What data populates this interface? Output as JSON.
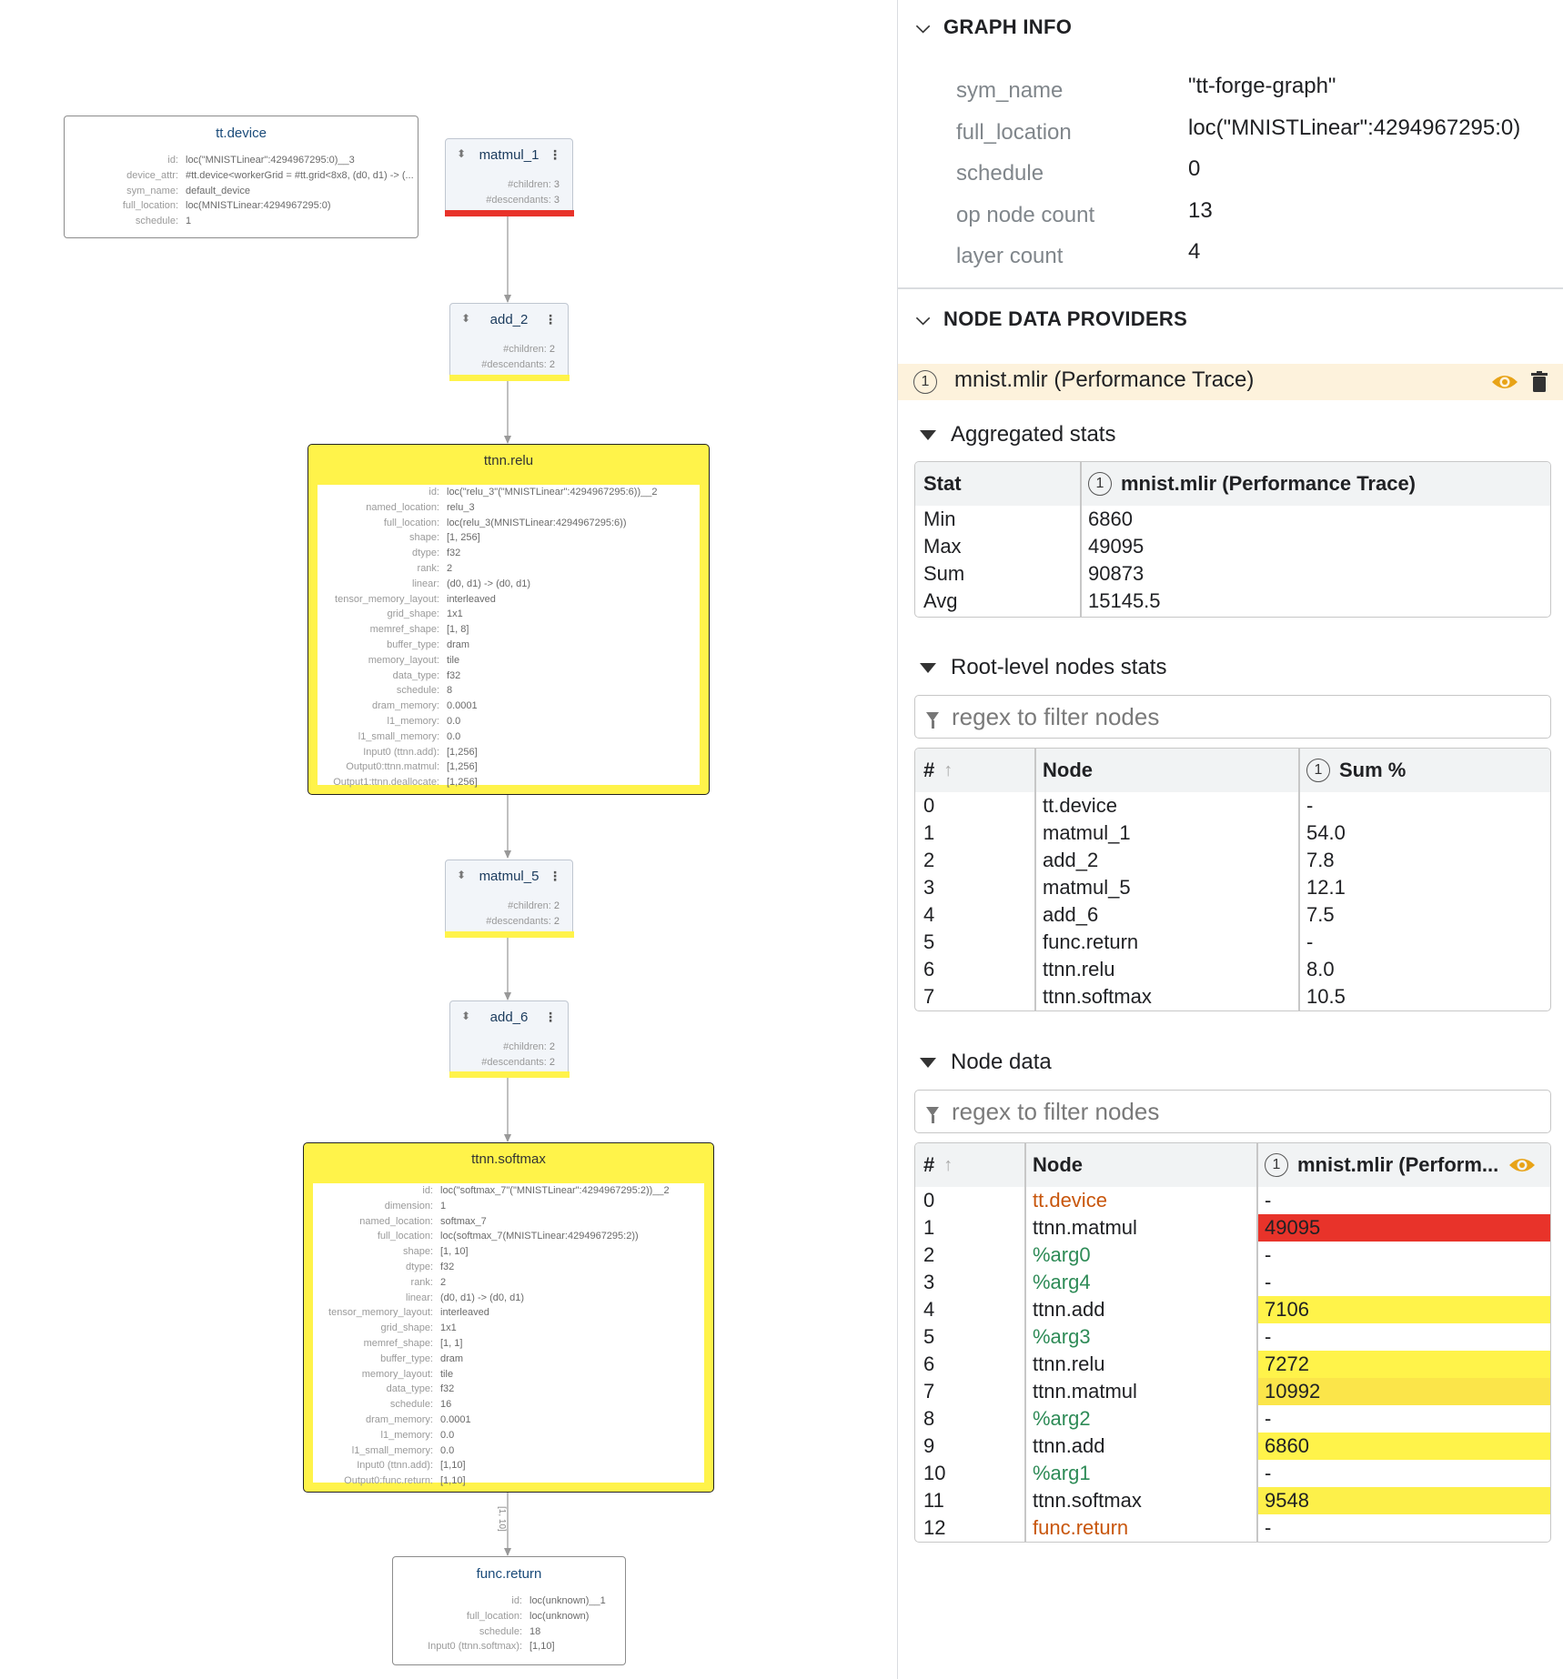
{
  "graph": {
    "tt_device": {
      "title": "tt.device",
      "attrs": [
        {
          "k": "id:",
          "v": "loc(\"MNISTLinear\":4294967295:0)__3"
        },
        {
          "k": "device_attr:",
          "v": "#tt.device<workerGrid = #tt.grid<8x8, (d0, d1) -> (..."
        },
        {
          "k": "sym_name:",
          "v": "default_device"
        },
        {
          "k": "full_location:",
          "v": "loc(MNISTLinear:4294967295:0)"
        },
        {
          "k": "schedule:",
          "v": "1"
        }
      ]
    },
    "groups": [
      {
        "name": "matmul_1",
        "children_label": "#children:",
        "children": "3",
        "descendants_label": "#descendants:",
        "descendants": "3",
        "bar_color": "#e8332a"
      },
      {
        "name": "add_2",
        "children_label": "#children:",
        "children": "2",
        "descendants_label": "#descendants:",
        "descendants": "2",
        "bar_color": "#fff34a"
      },
      {
        "name": "matmul_5",
        "children_label": "#children:",
        "children": "2",
        "descendants_label": "#descendants:",
        "descendants": "2",
        "bar_color": "#fff34a"
      },
      {
        "name": "add_6",
        "children_label": "#children:",
        "children": "2",
        "descendants_label": "#descendants:",
        "descendants": "2",
        "bar_color": "#fff34a"
      }
    ],
    "ttnn_relu": {
      "title": "ttnn.relu",
      "fill": "#fff34a",
      "attrs": [
        {
          "k": "id:",
          "v": "loc(\"relu_3\"(\"MNISTLinear\":4294967295:6))__2"
        },
        {
          "k": "named_location:",
          "v": "relu_3"
        },
        {
          "k": "full_location:",
          "v": "loc(relu_3(MNISTLinear:4294967295:6))"
        },
        {
          "k": "shape:",
          "v": "[1, 256]"
        },
        {
          "k": "dtype:",
          "v": "f32"
        },
        {
          "k": "rank:",
          "v": "2"
        },
        {
          "k": "linear:",
          "v": "(d0, d1) -> (d0, d1)"
        },
        {
          "k": "tensor_memory_layout:",
          "v": "interleaved"
        },
        {
          "k": "grid_shape:",
          "v": "1x1"
        },
        {
          "k": "memref_shape:",
          "v": "[1, 8]"
        },
        {
          "k": "buffer_type:",
          "v": "dram"
        },
        {
          "k": "memory_layout:",
          "v": "tile"
        },
        {
          "k": "data_type:",
          "v": "f32"
        },
        {
          "k": "schedule:",
          "v": "8"
        },
        {
          "k": "dram_memory:",
          "v": "0.0001"
        },
        {
          "k": "l1_memory:",
          "v": "0.0"
        },
        {
          "k": "l1_small_memory:",
          "v": "0.0"
        },
        {
          "k": "Input0 (ttnn.add):",
          "v": "[1,256]"
        },
        {
          "k": "Output0:ttnn.matmul:",
          "v": "[1,256]"
        },
        {
          "k": "Output1:ttnn.deallocate:",
          "v": "[1,256]"
        }
      ]
    },
    "ttnn_softmax": {
      "title": "ttnn.softmax",
      "fill": "#fff34a",
      "attrs": [
        {
          "k": "id:",
          "v": "loc(\"softmax_7\"(\"MNISTLinear\":4294967295:2))__2"
        },
        {
          "k": "dimension:",
          "v": "1"
        },
        {
          "k": "named_location:",
          "v": "softmax_7"
        },
        {
          "k": "full_location:",
          "v": "loc(softmax_7(MNISTLinear:4294967295:2))"
        },
        {
          "k": "shape:",
          "v": "[1, 10]"
        },
        {
          "k": "dtype:",
          "v": "f32"
        },
        {
          "k": "rank:",
          "v": "2"
        },
        {
          "k": "linear:",
          "v": "(d0, d1) -> (d0, d1)"
        },
        {
          "k": "tensor_memory_layout:",
          "v": "interleaved"
        },
        {
          "k": "grid_shape:",
          "v": "1x1"
        },
        {
          "k": "memref_shape:",
          "v": "[1, 1]"
        },
        {
          "k": "buffer_type:",
          "v": "dram"
        },
        {
          "k": "memory_layout:",
          "v": "tile"
        },
        {
          "k": "data_type:",
          "v": "f32"
        },
        {
          "k": "schedule:",
          "v": "16"
        },
        {
          "k": "dram_memory:",
          "v": "0.0001"
        },
        {
          "k": "l1_memory:",
          "v": "0.0"
        },
        {
          "k": "l1_small_memory:",
          "v": "0.0"
        },
        {
          "k": "Input0 (ttnn.add):",
          "v": "[1,10]"
        },
        {
          "k": "Output0:func.return:",
          "v": "[1,10]"
        }
      ]
    },
    "func_return": {
      "title": "func.return",
      "attrs": [
        {
          "k": "id:",
          "v": "loc(unknown)__1"
        },
        {
          "k": "full_location:",
          "v": "loc(unknown)"
        },
        {
          "k": "schedule:",
          "v": "18"
        },
        {
          "k": "Input0 (ttnn.softmax):",
          "v": "[1,10]"
        }
      ]
    },
    "edge_label": "[1, 10]"
  },
  "panel": {
    "graph_info": {
      "title": "GRAPH INFO",
      "rows": [
        {
          "k": "sym_name",
          "v": "\"tt-forge-graph\""
        },
        {
          "k": "full_location",
          "v": "loc(\"MNISTLinear\":4294967295:0)"
        },
        {
          "k": "schedule",
          "v": "0"
        },
        {
          "k": "op node count",
          "v": "13"
        },
        {
          "k": "layer count",
          "v": "4"
        }
      ]
    },
    "node_data_providers": {
      "title": "NODE DATA PROVIDERS",
      "provider_index": "1",
      "provider_name": "mnist.mlir (Performance Trace)",
      "eye_icon": "eye-icon",
      "trash_icon": "trash-icon"
    },
    "aggregated": {
      "title": "Aggregated stats",
      "col_stat": "Stat",
      "col_index": "1",
      "col_provider": "mnist.mlir (Performance Trace)",
      "rows": [
        {
          "stat": "Min",
          "value": "6860"
        },
        {
          "stat": "Max",
          "value": "49095"
        },
        {
          "stat": "Sum",
          "value": "90873"
        },
        {
          "stat": "Avg",
          "value": "15145.5"
        }
      ]
    },
    "root_stats": {
      "title": "Root-level nodes stats",
      "filter_placeholder": "regex to filter nodes",
      "col_hash": "#",
      "col_node": "Node",
      "col_index": "1",
      "col_sum": "Sum %",
      "rows": [
        {
          "i": "0",
          "node": "tt.device",
          "sum": "-"
        },
        {
          "i": "1",
          "node": "matmul_1",
          "sum": "54.0"
        },
        {
          "i": "2",
          "node": "add_2",
          "sum": "7.8"
        },
        {
          "i": "3",
          "node": "matmul_5",
          "sum": "12.1"
        },
        {
          "i": "4",
          "node": "add_6",
          "sum": "7.5"
        },
        {
          "i": "5",
          "node": "func.return",
          "sum": "-"
        },
        {
          "i": "6",
          "node": "ttnn.relu",
          "sum": "8.0"
        },
        {
          "i": "7",
          "node": "ttnn.softmax",
          "sum": "10.5"
        }
      ]
    },
    "node_data": {
      "title": "Node data",
      "filter_placeholder": "regex to filter nodes",
      "col_hash": "#",
      "col_node": "Node",
      "col_index": "1",
      "col_provider": "mnist.mlir (Perform...",
      "rows": [
        {
          "i": "0",
          "node": "tt.device",
          "value": "-",
          "kind": "orange",
          "heat": ""
        },
        {
          "i": "1",
          "node": "ttnn.matmul",
          "value": "49095",
          "kind": "plain",
          "heat": "#e8332a"
        },
        {
          "i": "2",
          "node": "%arg0",
          "value": "-",
          "kind": "green",
          "heat": ""
        },
        {
          "i": "3",
          "node": "%arg4",
          "value": "-",
          "kind": "green",
          "heat": ""
        },
        {
          "i": "4",
          "node": "ttnn.add",
          "value": "7106",
          "kind": "plain",
          "heat": "#fff34a"
        },
        {
          "i": "5",
          "node": "%arg3",
          "value": "-",
          "kind": "green",
          "heat": ""
        },
        {
          "i": "6",
          "node": "ttnn.relu",
          "value": "7272",
          "kind": "plain",
          "heat": "#fff34a"
        },
        {
          "i": "7",
          "node": "ttnn.matmul",
          "value": "10992",
          "kind": "plain",
          "heat": "#fbe54a"
        },
        {
          "i": "8",
          "node": "%arg2",
          "value": "-",
          "kind": "green",
          "heat": ""
        },
        {
          "i": "9",
          "node": "ttnn.add",
          "value": "6860",
          "kind": "plain",
          "heat": "#fff34a"
        },
        {
          "i": "10",
          "node": "%arg1",
          "value": "-",
          "kind": "green",
          "heat": ""
        },
        {
          "i": "11",
          "node": "ttnn.softmax",
          "value": "9548",
          "kind": "plain",
          "heat": "#fdf04a"
        },
        {
          "i": "12",
          "node": "func.return",
          "value": "-",
          "kind": "orange",
          "heat": ""
        }
      ]
    },
    "colors": {
      "orange": "#c8560c",
      "green": "#2e8b57",
      "accent_eye": "#e8a317"
    }
  }
}
